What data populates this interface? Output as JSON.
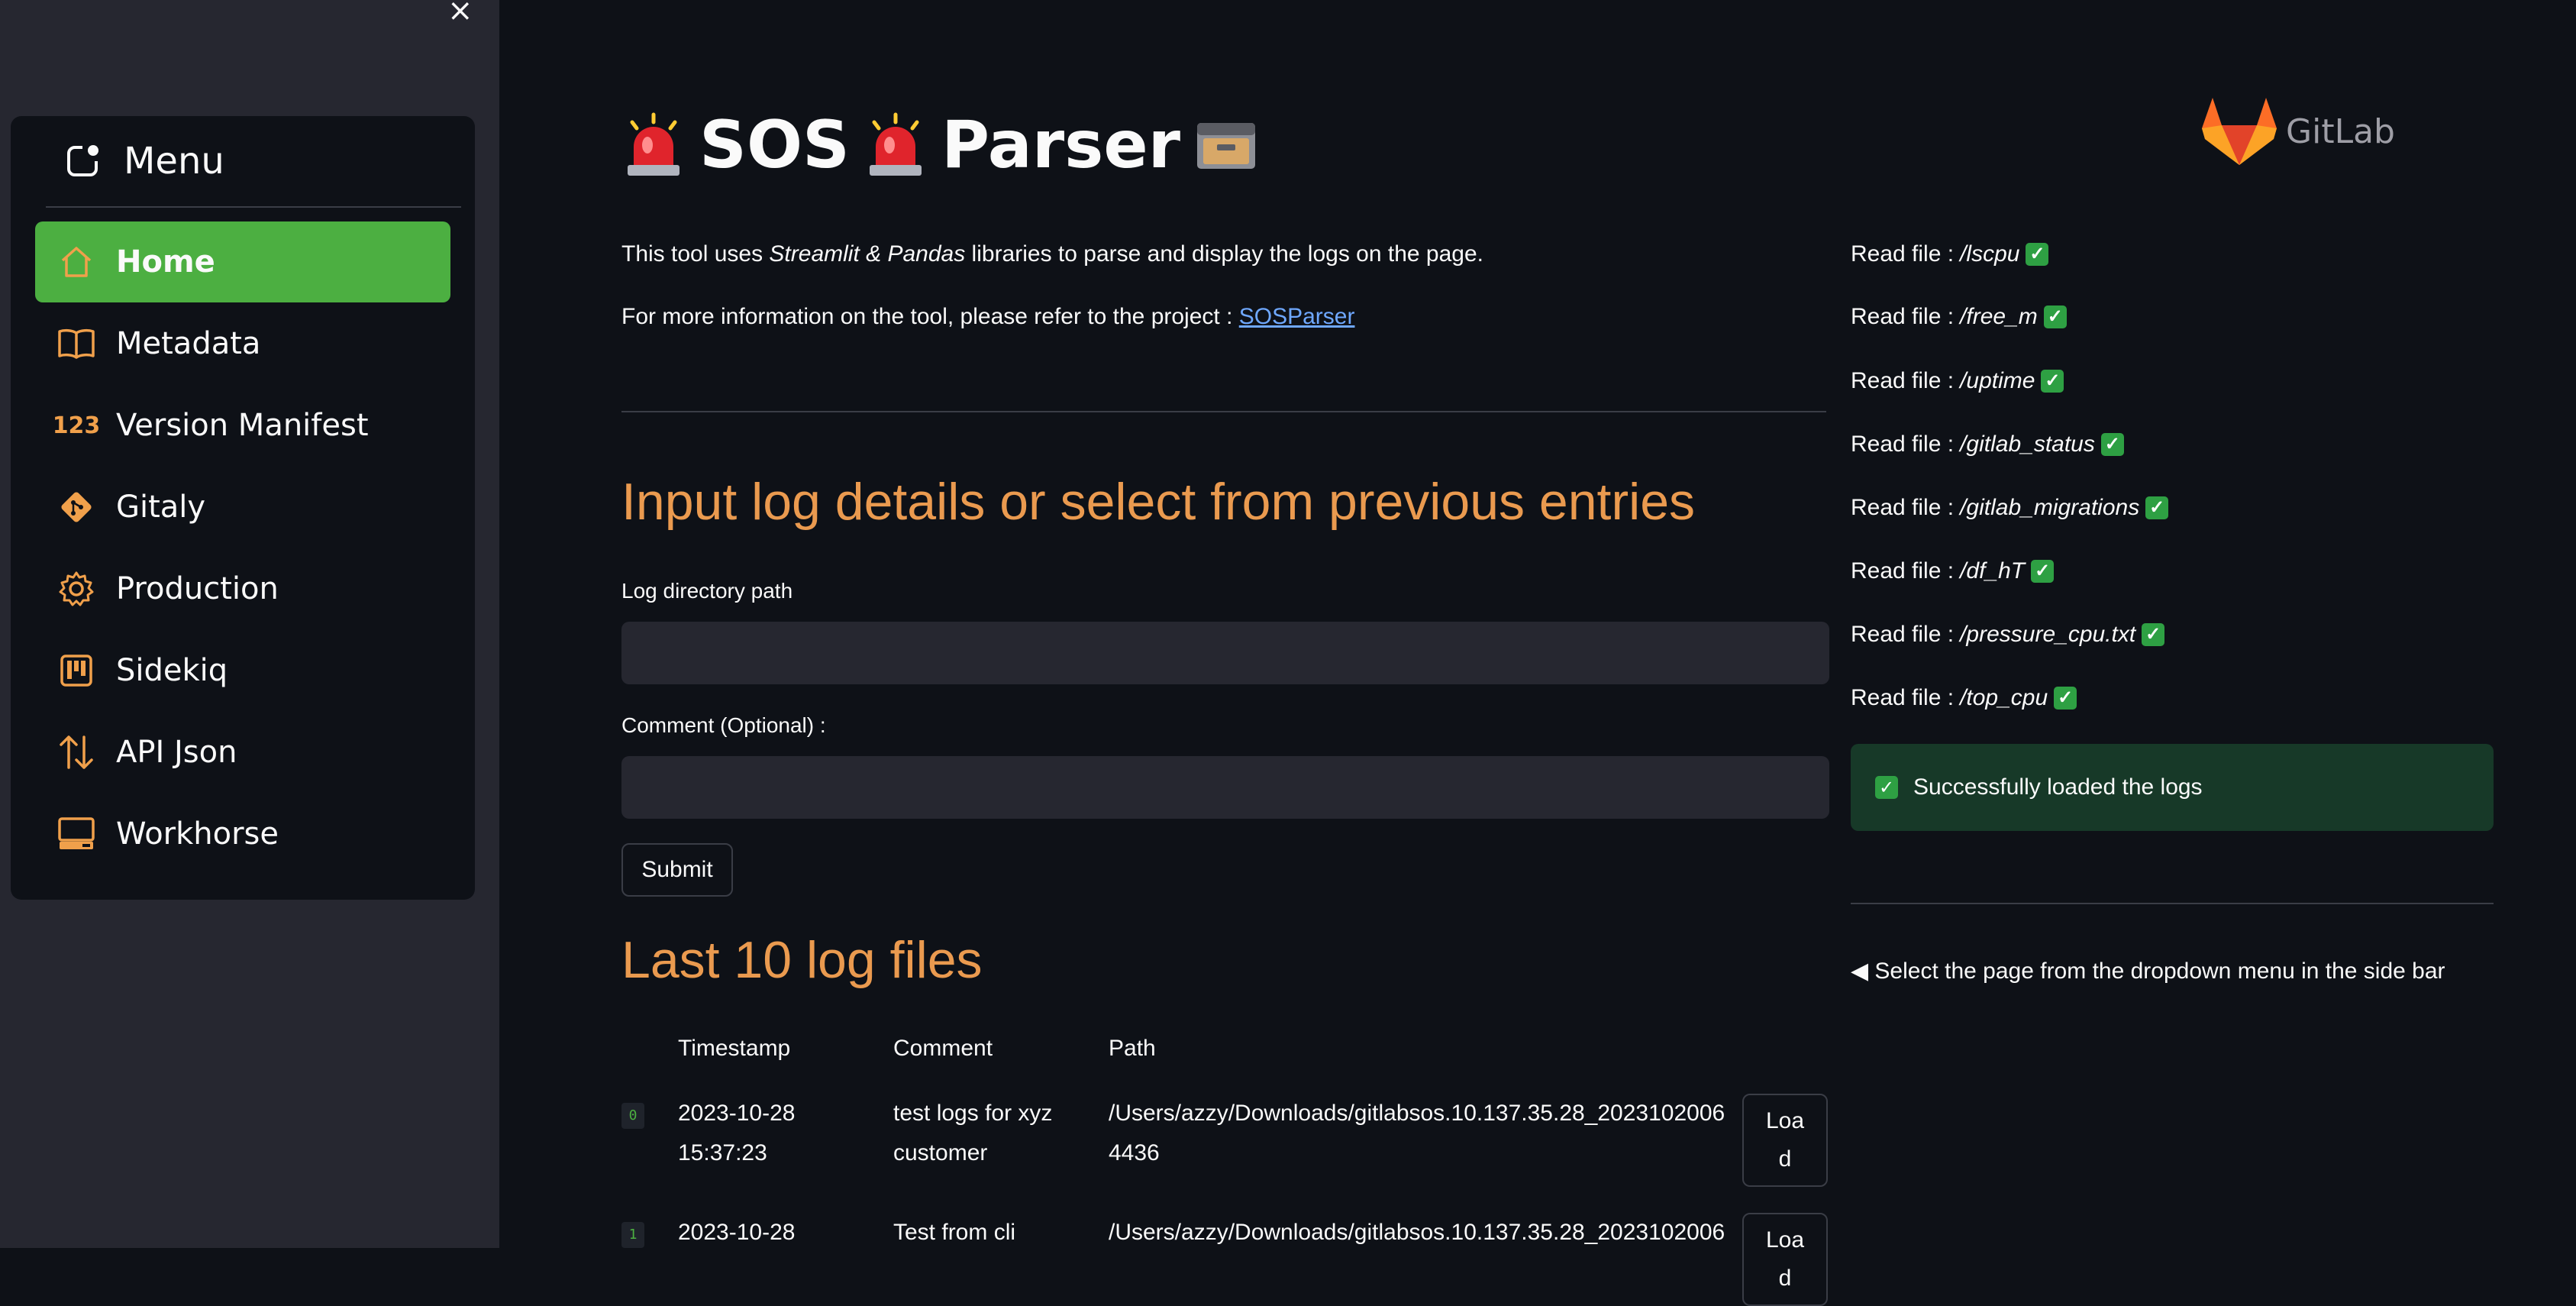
{
  "sidebar": {
    "close_glyph": "×",
    "menu_title": "Menu",
    "items": [
      {
        "label": "Home",
        "icon": "home-icon",
        "active": true
      },
      {
        "label": "Metadata",
        "icon": "book-icon"
      },
      {
        "label": "Version Manifest",
        "icon": "numbers-icon",
        "icon_text": "123"
      },
      {
        "label": "Gitaly",
        "icon": "git-icon"
      },
      {
        "label": "Production",
        "icon": "gear-icon"
      },
      {
        "label": "Sidekiq",
        "icon": "kanban-icon"
      },
      {
        "label": "API Json",
        "icon": "arrows-updown-icon"
      },
      {
        "label": "Workhorse",
        "icon": "pc-icon"
      }
    ]
  },
  "header": {
    "title_word1": "SOS",
    "title_word2": "Parser",
    "logo_text": "GitLab"
  },
  "intro": {
    "line1_pre": "This tool uses ",
    "line1_em": "Streamlit & Pandas",
    "line1_post": " libraries to parse and display the logs on the page.",
    "line2_pre": "For more information on the tool, please refer to the project : ",
    "line2_link": "SOSParser"
  },
  "form": {
    "heading": "Input log details or select from previous entries",
    "path_label": "Log directory path",
    "path_value": "",
    "comment_label": "Comment (Optional) :",
    "comment_value": "",
    "submit_label": "Submit"
  },
  "log_table": {
    "heading": "Last 10 log files",
    "columns": [
      "Timestamp",
      "Comment",
      "Path"
    ],
    "rows": [
      {
        "index": "0",
        "timestamp_1": "2023-10-28",
        "timestamp_2": "15:37:23",
        "comment_1": "test logs for xyz",
        "comment_2": "customer",
        "path_1": "/Users/azzy/Downloads/gitlabsos.10.137.35.28_2023102006",
        "path_2": "4436",
        "load_1": "Loa",
        "load_2": "d"
      },
      {
        "index": "1",
        "timestamp_1": "2023-10-28",
        "timestamp_2": "",
        "comment_1": "Test from cli",
        "comment_2": "",
        "path_1": "/Users/azzy/Downloads/gitlabsos.10.137.35.28_2023102006",
        "path_2": "",
        "load_1": "Loa",
        "load_2": "d"
      }
    ]
  },
  "status": {
    "read_prefix": "Read file : ",
    "files": [
      "/lscpu",
      "/free_m",
      "/uptime",
      "/gitlab_status",
      "/gitlab_migrations",
      "/df_hT",
      "/pressure_cpu.txt",
      "/top_cpu"
    ],
    "check_glyph": "✓",
    "success_text": "Successfully loaded the logs",
    "hint": "◀ Select the page from the dropdown menu in the side bar"
  },
  "colors": {
    "background": "#0e1117",
    "sidebar": "#262730",
    "accent_active": "#4caf41",
    "heading_orange": "#ea9a4f",
    "icon_orange": "#f0a04b",
    "success_bg": "#173928",
    "link": "#6fa8ff"
  }
}
